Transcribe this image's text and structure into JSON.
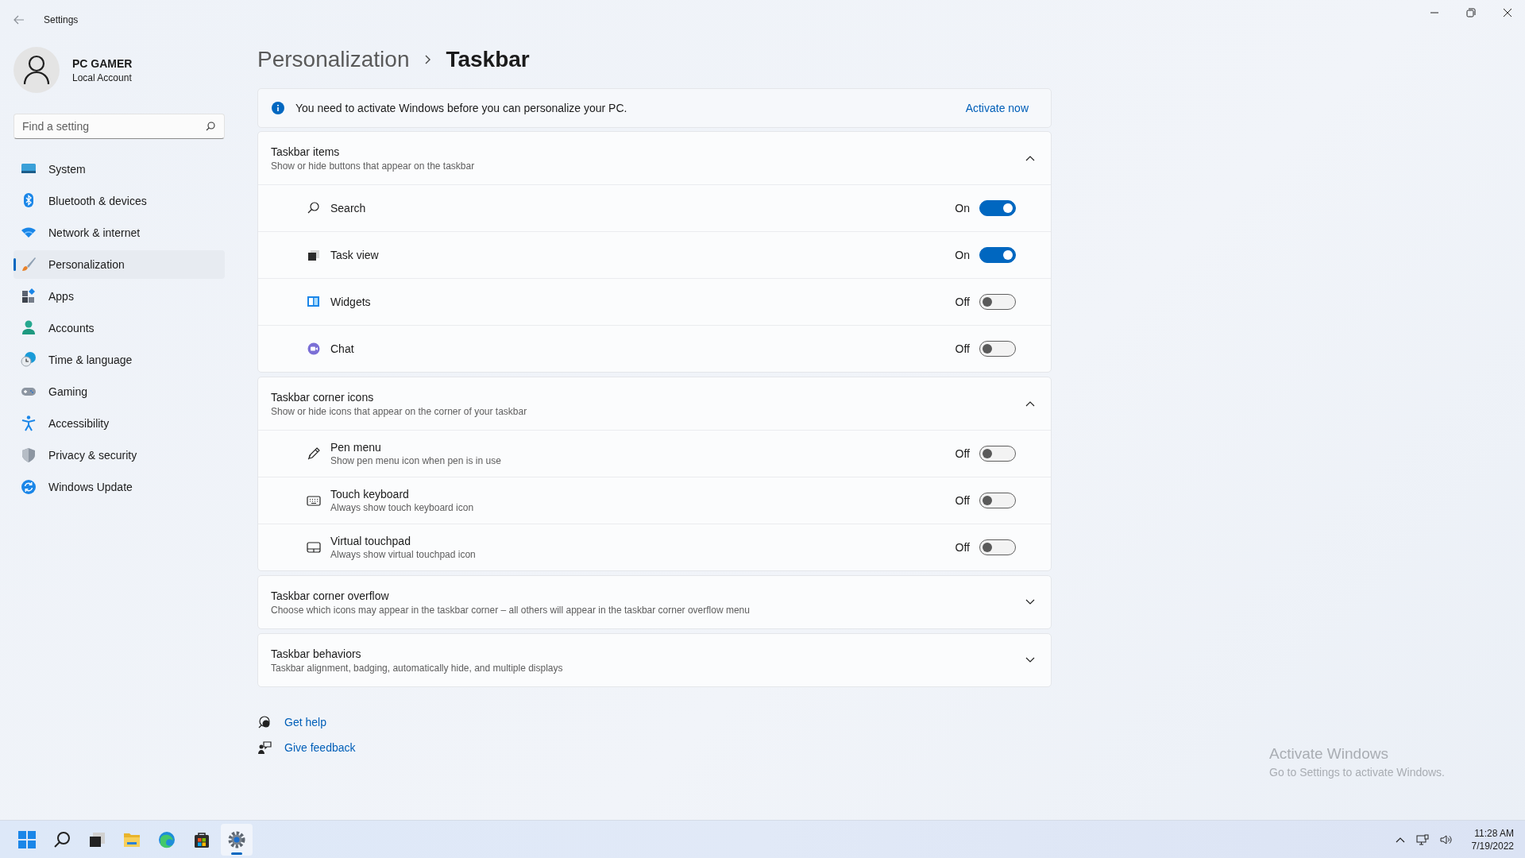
{
  "window": {
    "title": "Settings"
  },
  "profile": {
    "name": "PC GAMER",
    "account": "Local Account"
  },
  "search": {
    "placeholder": "Find a setting"
  },
  "nav": [
    {
      "label": "System",
      "kind": "system",
      "selected": false
    },
    {
      "label": "Bluetooth & devices",
      "kind": "bluetooth",
      "selected": false
    },
    {
      "label": "Network & internet",
      "kind": "network",
      "selected": false
    },
    {
      "label": "Personalization",
      "kind": "brush",
      "selected": true
    },
    {
      "label": "Apps",
      "kind": "apps",
      "selected": false
    },
    {
      "label": "Accounts",
      "kind": "accounts",
      "selected": false
    },
    {
      "label": "Time & language",
      "kind": "time",
      "selected": false
    },
    {
      "label": "Gaming",
      "kind": "gaming",
      "selected": false
    },
    {
      "label": "Accessibility",
      "kind": "accessibility",
      "selected": false
    },
    {
      "label": "Privacy & security",
      "kind": "shield",
      "selected": false
    },
    {
      "label": "Windows Update",
      "kind": "update",
      "selected": false
    }
  ],
  "breadcrumb": {
    "parent": "Personalization",
    "current": "Taskbar"
  },
  "banner": {
    "message": "You need to activate Windows before you can personalize your PC.",
    "action": "Activate now"
  },
  "sections": [
    {
      "title": "Taskbar items",
      "subtitle": "Show or hide buttons that appear on the taskbar",
      "expanded": true,
      "items": [
        {
          "label": "Search",
          "kind": "search",
          "on": true,
          "state_label": "On"
        },
        {
          "label": "Task view",
          "kind": "taskview",
          "on": true,
          "state_label": "On"
        },
        {
          "label": "Widgets",
          "kind": "widgets",
          "on": false,
          "state_label": "Off"
        },
        {
          "label": "Chat",
          "kind": "chat",
          "on": false,
          "state_label": "Off"
        }
      ]
    },
    {
      "title": "Taskbar corner icons",
      "subtitle": "Show or hide icons that appear on the corner of your taskbar",
      "expanded": true,
      "items": [
        {
          "label": "Pen menu",
          "description": "Show pen menu icon when pen is in use",
          "kind": "pen",
          "on": false,
          "state_label": "Off"
        },
        {
          "label": "Touch keyboard",
          "description": "Always show touch keyboard icon",
          "kind": "keyboard",
          "on": false,
          "state_label": "Off"
        },
        {
          "label": "Virtual touchpad",
          "description": "Always show virtual touchpad icon",
          "kind": "touchpad",
          "on": false,
          "state_label": "Off"
        }
      ]
    },
    {
      "title": "Taskbar corner overflow",
      "subtitle": "Choose which icons may appear in the taskbar corner – all others will appear in the taskbar corner overflow menu",
      "expanded": false
    },
    {
      "title": "Taskbar behaviors",
      "subtitle": "Taskbar alignment, badging, automatically hide, and multiple displays",
      "expanded": false
    }
  ],
  "links": [
    {
      "label": "Get help",
      "kind": "help"
    },
    {
      "label": "Give feedback",
      "kind": "feedback"
    }
  ],
  "watermark": {
    "title": "Activate Windows",
    "message": "Go to Settings to activate Windows."
  },
  "taskbar": {
    "apps": [
      {
        "kind": "start",
        "active": false
      },
      {
        "kind": "search",
        "active": false
      },
      {
        "kind": "taskview",
        "active": false
      },
      {
        "kind": "folder",
        "active": false
      },
      {
        "kind": "browser",
        "active": false
      },
      {
        "kind": "store",
        "active": false
      },
      {
        "kind": "gear",
        "active": true
      }
    ],
    "time": "11:28 AM",
    "date": "7/19/2022"
  }
}
